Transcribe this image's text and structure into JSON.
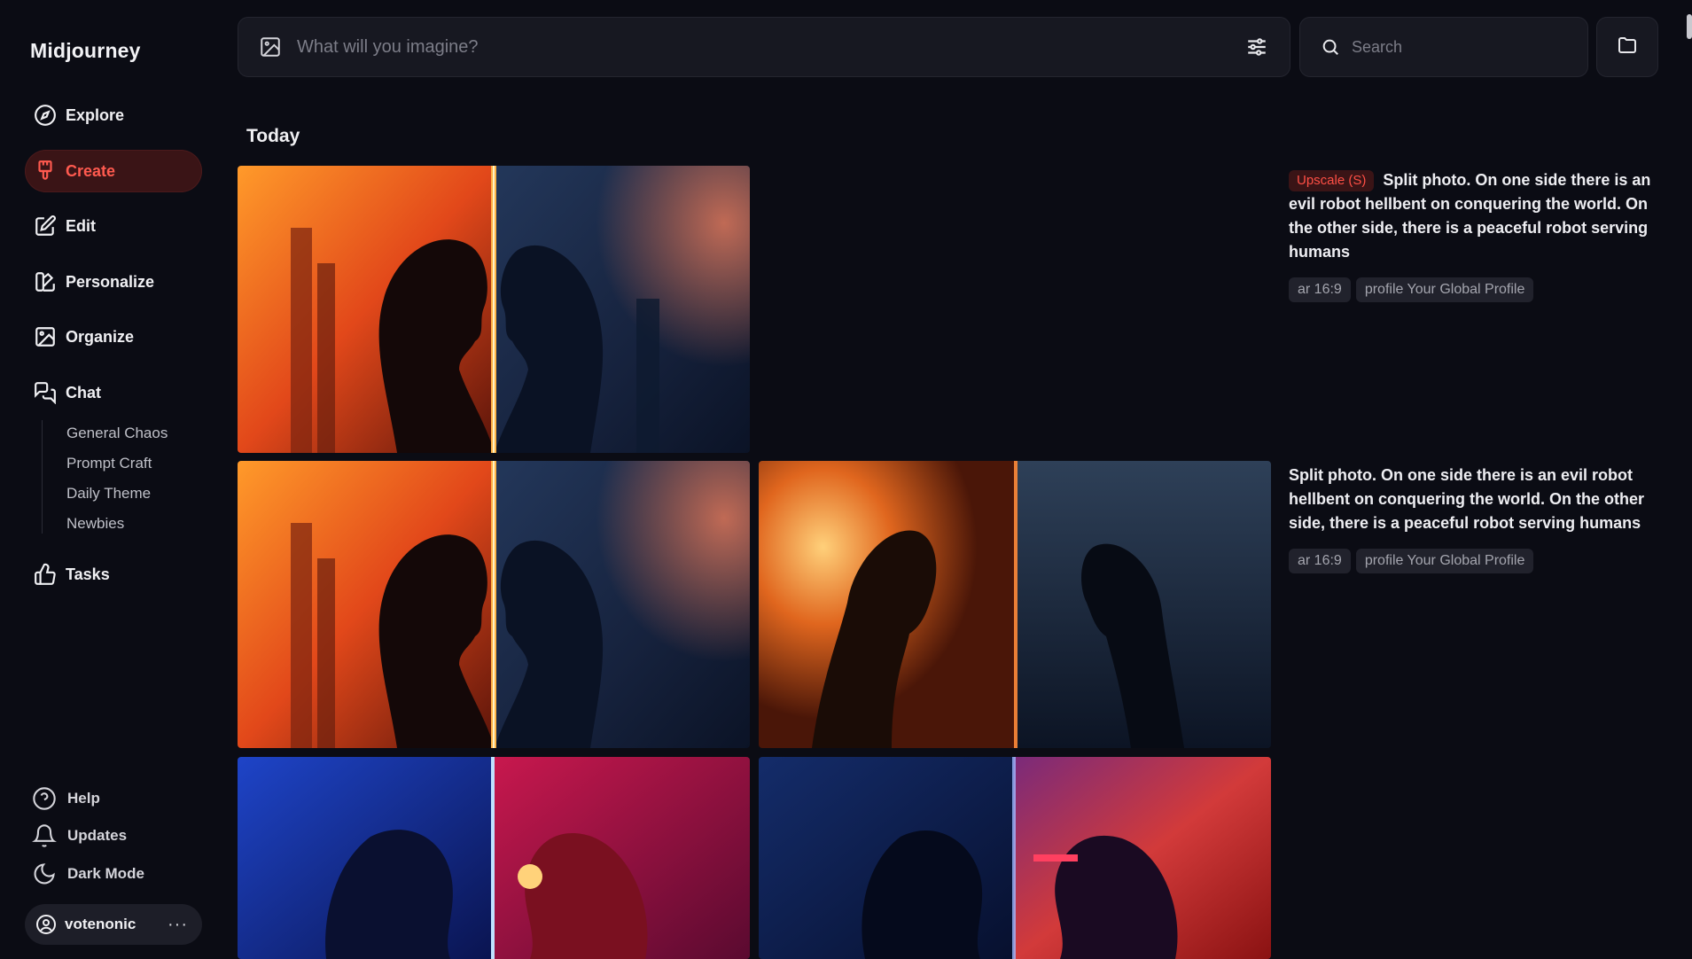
{
  "app": {
    "title": "Midjourney"
  },
  "nav": {
    "explore": "Explore",
    "create": "Create",
    "edit": "Edit",
    "personalize": "Personalize",
    "organize": "Organize",
    "chat": "Chat",
    "chat_rooms": [
      "General Chaos",
      "Prompt Craft",
      "Daily Theme",
      "Newbies"
    ],
    "tasks": "Tasks"
  },
  "bottom": {
    "help": "Help",
    "updates": "Updates",
    "dark_mode": "Dark Mode",
    "username": "votenonic",
    "more": "···"
  },
  "prompt": {
    "placeholder": "What will you imagine?"
  },
  "search": {
    "placeholder": "Search"
  },
  "feed": {
    "section": "Today",
    "jobs": [
      {
        "badge": "Upscale (S)",
        "prompt": "Split photo. On one side there is an evil robot hellbent on conquering the world. On the other side, there is a peaceful robot serving humans",
        "tags": [
          "ar 16:9",
          "profile Your Global Profile"
        ]
      },
      {
        "badge": "",
        "prompt": "Split photo. On one side there is an evil robot hellbent on conquering the world. On the other side, there is a peaceful robot serving humans",
        "tags": [
          "ar 16:9",
          "profile Your Global Profile"
        ]
      }
    ]
  },
  "colors": {
    "accent": "#ff5a4f",
    "background": "#0b0c14",
    "panel": "#171821"
  }
}
